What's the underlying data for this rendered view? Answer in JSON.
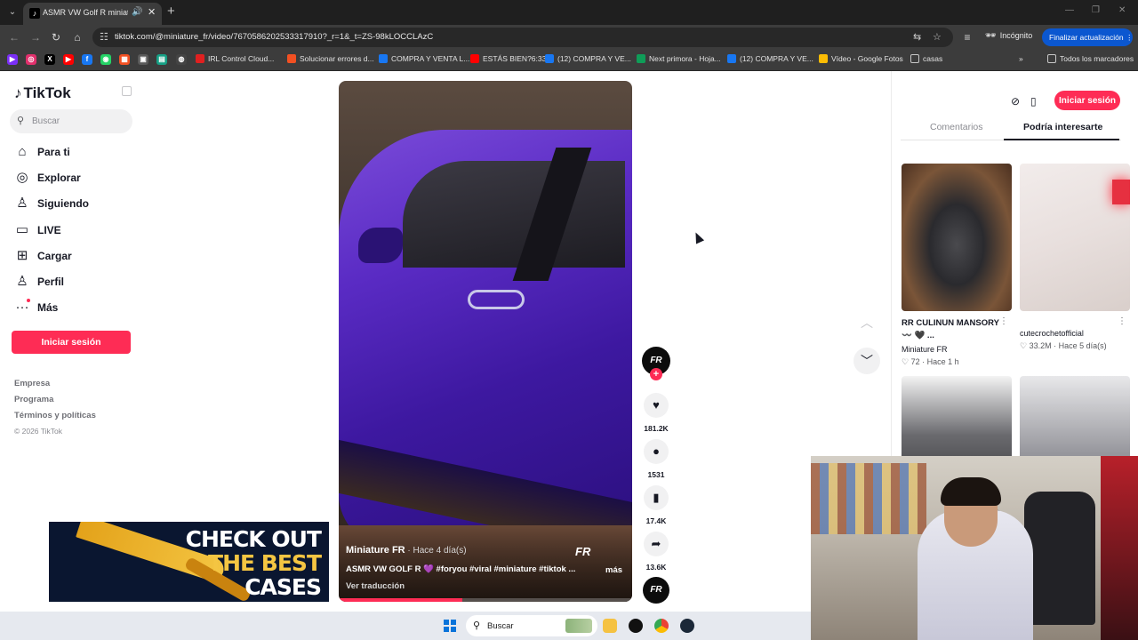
{
  "browser": {
    "tab_title": "ASMR VW Golf R miniature",
    "url": "tiktok.com/@miniature_fr/video/7670586202533317910?_r=1&_t=ZS-98kLOCCLAzC",
    "incognito_label": "Incógnito",
    "update_button": "Finalizar actualización",
    "bookmarks": [
      {
        "label": "IRL Control Cloud...",
        "color": "#e02020"
      },
      {
        "label": "Solucionar errores d...",
        "color": "#f25022"
      },
      {
        "label": "COMPRA Y VENTA L...",
        "color": "#1877f2"
      },
      {
        "label": "ESTÁS BIEN?6:33",
        "color": "#ff0000"
      },
      {
        "label": "(12) COMPRA Y VE...",
        "color": "#1877f2"
      },
      {
        "label": "Next primora - Hoja...",
        "color": "#0f9d58"
      },
      {
        "label": "(12) COMPRA Y VE...",
        "color": "#1877f2"
      },
      {
        "label": "Vídeo - Google Fotos",
        "color": "#fbbc04"
      },
      {
        "label": "casas",
        "color": "#c8c8c8"
      }
    ],
    "all_bookmarks": "Todos los marcadores"
  },
  "tiktok": {
    "logo": "TikTok",
    "search_placeholder": "Buscar",
    "nav": [
      {
        "label": "Para ti",
        "icon": "home-icon"
      },
      {
        "label": "Explorar",
        "icon": "compass-icon"
      },
      {
        "label": "Siguiendo",
        "icon": "following-icon"
      },
      {
        "label": "LIVE",
        "icon": "live-icon"
      },
      {
        "label": "Cargar",
        "icon": "upload-icon"
      },
      {
        "label": "Perfil",
        "icon": "profile-icon"
      },
      {
        "label": "Más",
        "icon": "more-icon"
      }
    ],
    "login_button": "Iniciar sesión",
    "footer": [
      "Empresa",
      "Programa",
      "Términos y políticas"
    ],
    "copyright": "© 2026 TikTok",
    "ad": {
      "line1": "CHECK OUT",
      "line2": "THE BEST",
      "line3": "CASES"
    }
  },
  "video": {
    "author": "Miniature FR",
    "time_ago": " · Hace 4 día(s)",
    "caption": "ASMR VW GOLF R 💜 #foryou #viral #miniature #tiktok ...",
    "more": "más",
    "translate": "Ver traducción",
    "watermark": "FR",
    "progress": 0.42,
    "avatar_text": "FR",
    "likes": "181.2K",
    "comments": "1531",
    "saves": "17.4K",
    "shares": "13.6K"
  },
  "panel": {
    "login_button": "Iniciar sesión",
    "tab_comments": "Comentarios",
    "tab_may_interest": "Podría interesarte",
    "cards": [
      {
        "title": "RR CULINUN MANSORY 〰️ 🖤 ...",
        "author": "Miniature FR",
        "meta": "♡ 72 · Hace 1 h"
      },
      {
        "title": "",
        "author": "cutecrochetofficial",
        "meta": "♡ 33.2M · Hace 5 día(s)"
      }
    ]
  },
  "taskbar": {
    "search_label": "Buscar"
  }
}
